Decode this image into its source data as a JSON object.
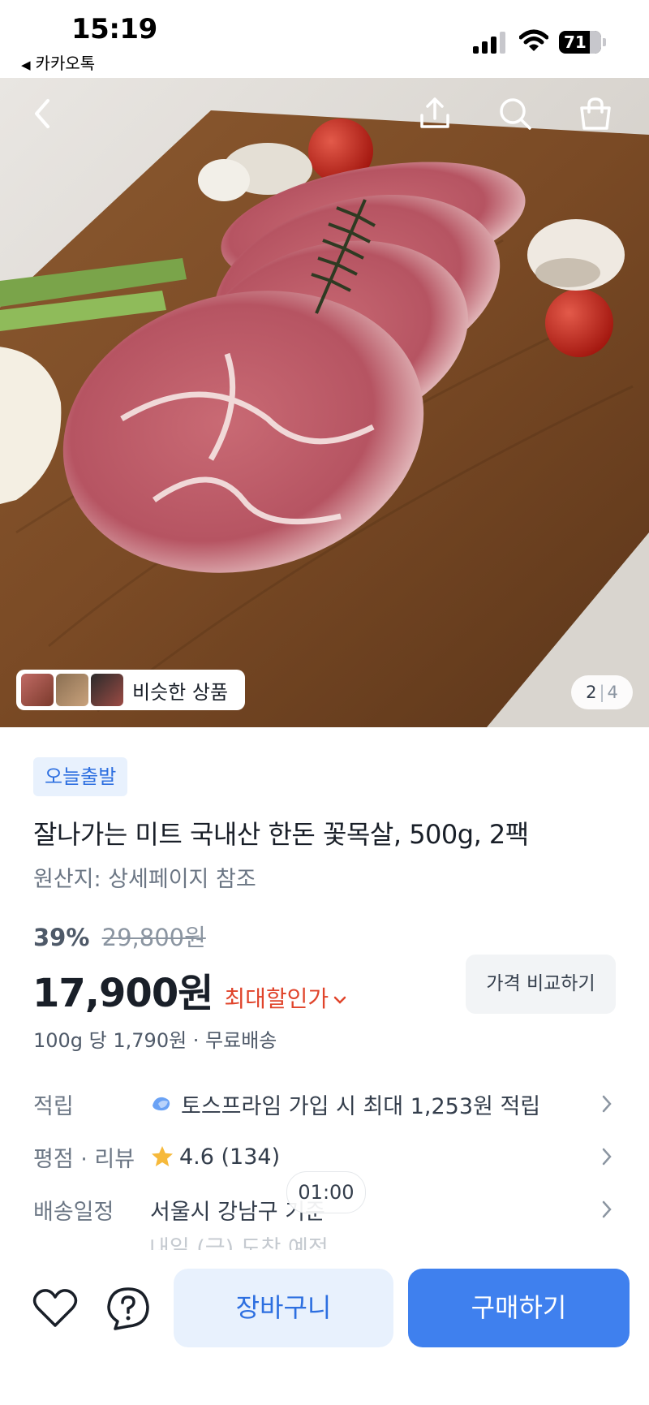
{
  "status_bar": {
    "time": "15:19",
    "back_app": "카카오톡",
    "battery": "71"
  },
  "hero": {
    "page_current": "2",
    "page_total": "4",
    "similar_label": "비슷한 상품"
  },
  "product": {
    "badge": "오늘출발",
    "title": "잘나가는 미트 국내산 한돈 꽃목살, 500g, 2팩",
    "origin": "원산지: 상세페이지 참조",
    "discount_rate": "39%",
    "original_price": "29,800원",
    "price": "17,900원",
    "max_discount_label": "최대할인가",
    "compare_label": "가격 비교하기",
    "unit_price": "100g 당 1,790원 · 무료배송"
  },
  "info": {
    "points_label": "적립",
    "points_value": "토스프라임 가입 시 최대 1,253원 적립",
    "rating_label": "평점 · 리뷰",
    "rating_value": "4.6 (134)",
    "delivery_label": "배송일정",
    "delivery_value": "서울시 강남구 기준",
    "delivery_sub": "내일 (금) 도착 예정",
    "timer": "01:00"
  },
  "actions": {
    "cart": "장바구니",
    "buy": "구매하기"
  },
  "colors": {
    "accent": "#3f80ee",
    "discount": "#e0442b",
    "badge_bg": "#e8f1fd"
  }
}
